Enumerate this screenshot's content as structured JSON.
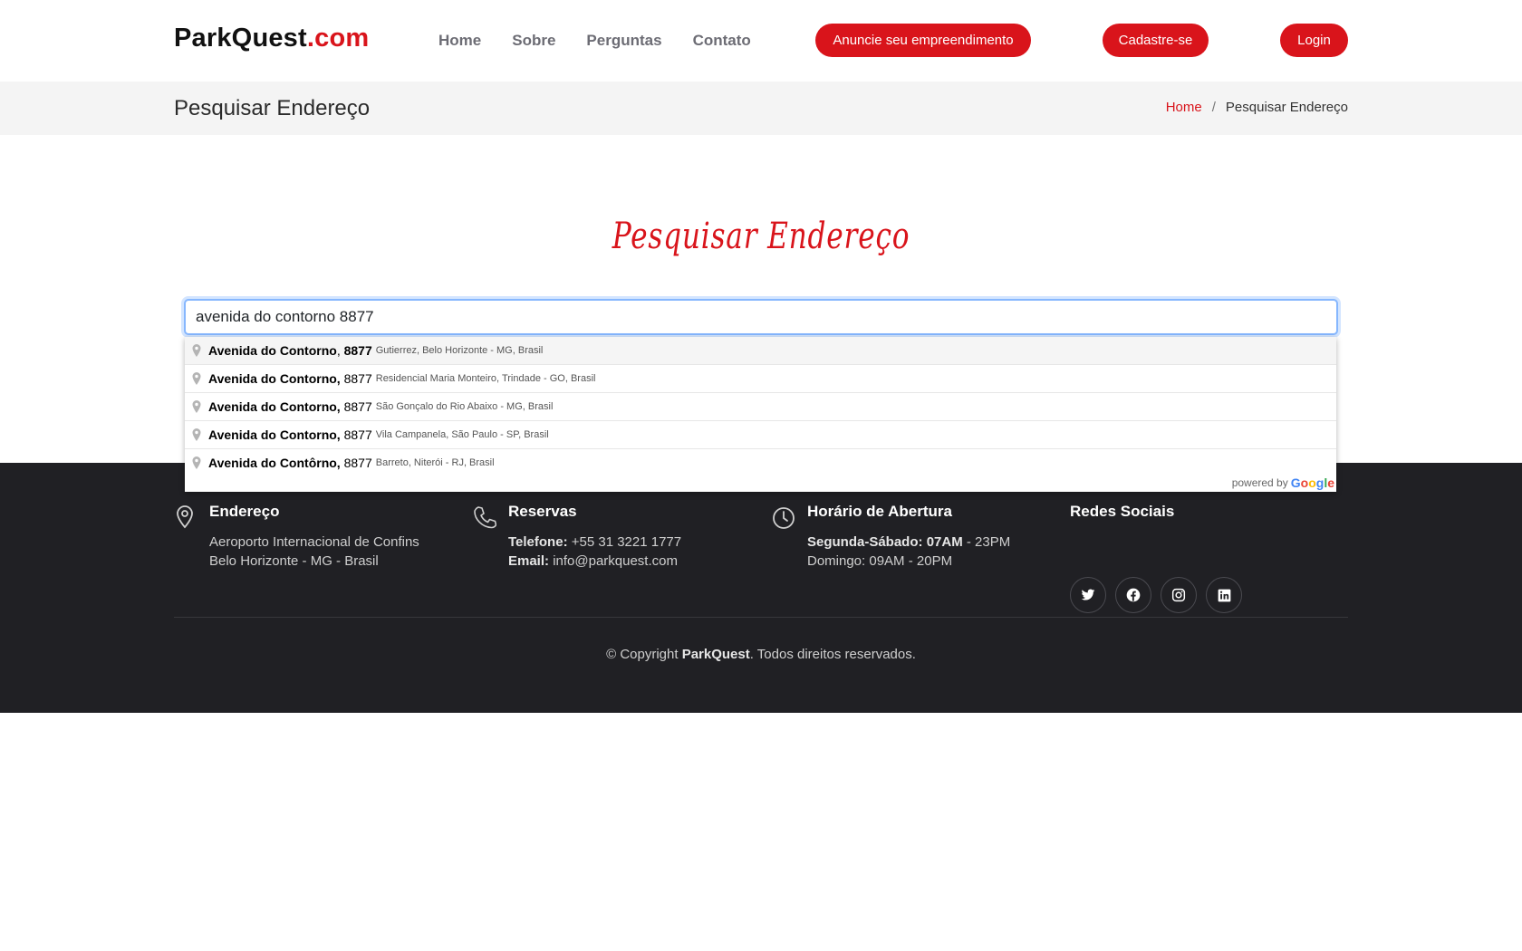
{
  "header": {
    "logo_main": "ParkQuest",
    "logo_tld": ".com",
    "nav": [
      "Home",
      "Sobre",
      "Perguntas",
      "Contato"
    ],
    "btn_anuncie": "Anuncie seu empreendimento",
    "btn_cadastre": "Cadastre-se",
    "btn_login": "Login",
    "accent_color": "#d9141b"
  },
  "band": {
    "title": "Pesquisar Endereço",
    "breadcrumb_home": "Home",
    "breadcrumb_sep": "/",
    "breadcrumb_current": "Pesquisar Endereço"
  },
  "main": {
    "heading": "Pesquisar Endereço",
    "search_value": "avenida do contorno 8877"
  },
  "autocomplete": {
    "items": [
      {
        "main": "Avenida do Contorno",
        "number": "8877",
        "sub": "Gutierrez, Belo Horizonte - MG, Brasil",
        "icon": "map-pin-icon"
      },
      {
        "main": "Avenida do Contorno,",
        "number": "8877",
        "sub": "Residencial Maria Monteiro, Trindade - GO, Brasil",
        "icon": "map-pin-icon"
      },
      {
        "main": "Avenida do Contorno,",
        "number": "8877",
        "sub": "São Gonçalo do Rio Abaixo - MG, Brasil",
        "icon": "map-pin-icon"
      },
      {
        "main": "Avenida do Contorno,",
        "number": "8877",
        "sub": "Vila Campanela, São Paulo - SP, Brasil",
        "icon": "map-pin-icon"
      },
      {
        "main": "Avenida do Contôrno,",
        "number": "8877",
        "sub": "Barreto, Niterói - RJ, Brasil",
        "icon": "map-pin-icon"
      }
    ],
    "powered_by": "powered by",
    "google": "Google"
  },
  "footer": {
    "endereco": {
      "title": "Endereço",
      "line1": "Aeroporto Internacional de Confins",
      "line2": "Belo Horizonte - MG - Brasil",
      "icon": "location-pin-icon"
    },
    "reservas": {
      "title": "Reservas",
      "phone_label": "Telefone:",
      "phone": "+55 31 3221 1777",
      "email_label": "Email:",
      "email": "info@parkquest.com",
      "icon": "phone-icon"
    },
    "horario": {
      "title": "Horário de Abertura",
      "weekday_label": "Segunda-Sábado:",
      "weekday_open": "07AM",
      "weekday_close": " - 23PM",
      "sunday": "Domingo: 09AM - 20PM",
      "icon": "clock-icon"
    },
    "redes": {
      "title": "Redes Sociais",
      "icons": [
        "twitter-icon",
        "facebook-icon",
        "instagram-icon",
        "linkedin-icon"
      ]
    },
    "copyright_prefix": "© Copyright ",
    "copyright_brand": "ParkQuest",
    "copyright_suffix": ". Todos direitos reservados."
  }
}
